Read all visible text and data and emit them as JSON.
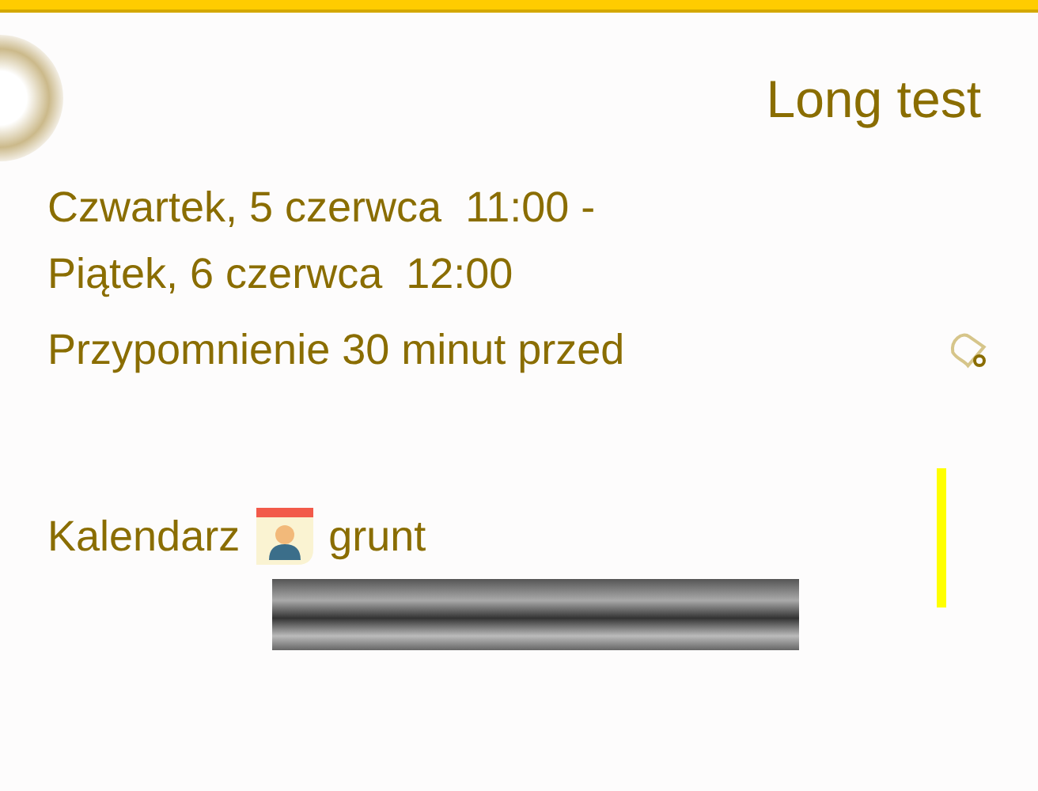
{
  "event": {
    "title": "Long test",
    "start": "Czwartek, 5 czerwca  11:00 -",
    "end": "Piątek, 6 czerwca  12:00",
    "reminder": "Przypomnienie 30 minut przed"
  },
  "calendar": {
    "label": "Kalendarz",
    "name": "grunt",
    "color": "#ffff00"
  }
}
